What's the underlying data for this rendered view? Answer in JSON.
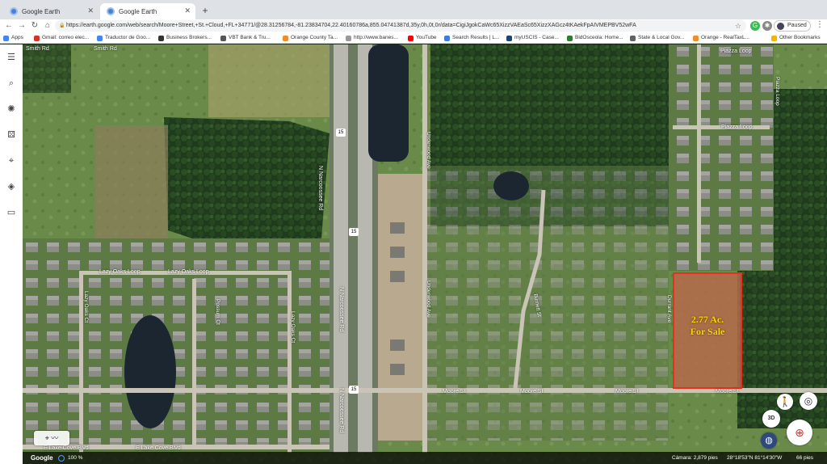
{
  "browser": {
    "tabs": [
      {
        "title": "Google Earth",
        "active": false
      },
      {
        "title": "Google Earth",
        "active": true
      }
    ],
    "url": "https://earth.google.com/web/search/Moore+Street,+St.+Cloud,+FL+34771/@28.31256784,-81.23834704,22.40160786a,855.04741387d,35y,0h,0t,0r/data=CigiJgokCaWc65XizzVAEaSc65XizzXAGcz4tKAekFpAIVMEPBV52wFA",
    "profile_status": "Paused"
  },
  "bookmarks": [
    {
      "label": "Apps",
      "color": "#4285f4"
    },
    {
      "label": "Gmail: correo elec...",
      "color": "#d93025"
    },
    {
      "label": "Traductor de Goo...",
      "color": "#4285f4"
    },
    {
      "label": "Business Brokers...",
      "color": "#333333"
    },
    {
      "label": "VBT Bank & Tru...",
      "color": "#555555"
    },
    {
      "label": "Orange County Ta...",
      "color": "#f28c28"
    },
    {
      "label": "http://www.banes...",
      "color": "#999999"
    },
    {
      "label": "YouTube",
      "color": "#ff0000"
    },
    {
      "label": "Search Results | L...",
      "color": "#3b7ddd"
    },
    {
      "label": "myUSCIS - Case...",
      "color": "#1a4480"
    },
    {
      "label": "BidOsceola: Home...",
      "color": "#2e7d32"
    },
    {
      "label": "State & Local Gov...",
      "color": "#5f6368"
    },
    {
      "label": "Orange - RealTaxL...",
      "color": "#f28c28"
    },
    {
      "label": "Other Bookmarks",
      "color": "#f5b400"
    }
  ],
  "map": {
    "streets": {
      "smith_rd": "Smith Rd",
      "narcoossee_top": "N Narcoossee Rd",
      "narcoossee_bottom": "N Narcoossee Rd",
      "route_shield": "15",
      "lazy_oaks_loop_1": "Lazy Oaks Loop",
      "lazy_oaks_loop_2": "Lazy Oaks Loop",
      "lazy_oaks_ct": "Lazy Oaks Ct",
      "possum_ct": "Possum Ct",
      "lazy_oaks_ct2": "Lazy Oaks Ct",
      "underwood_ave_top": "Underwood Ave",
      "underwood_ave_bottom": "Underwood Ave",
      "durrant_ave": "Durrant Ave",
      "burnett_st": "Burnett St",
      "moore_st_1": "Moore St",
      "moore_st_2": "Moore St",
      "moore_st_3": "Moore St",
      "moore_st_4": "Moore St",
      "piazza_loop_1": "Piazza Loop",
      "piazza_loop_2": "Piazza Loop",
      "piazza_loop_3": "Piazza Loop",
      "lake_cove_blvd_1": "E Lake Cove Blvd",
      "lake_cove_blvd_2": "E Lake Cove Blvd"
    },
    "parcel": {
      "line1": "2.77 Ac.",
      "line2": "For Sale",
      "border_color": "#e8301c",
      "text_color": "#f5d800"
    },
    "controls": {
      "view_3d": "3D"
    }
  },
  "statusbar": {
    "logo": "Google",
    "zoom": "100 %",
    "camera": "Cámara: 2,879 pies",
    "coords": "28°18'53\"N 81°14'30\"W",
    "elevation": "66 pies"
  }
}
